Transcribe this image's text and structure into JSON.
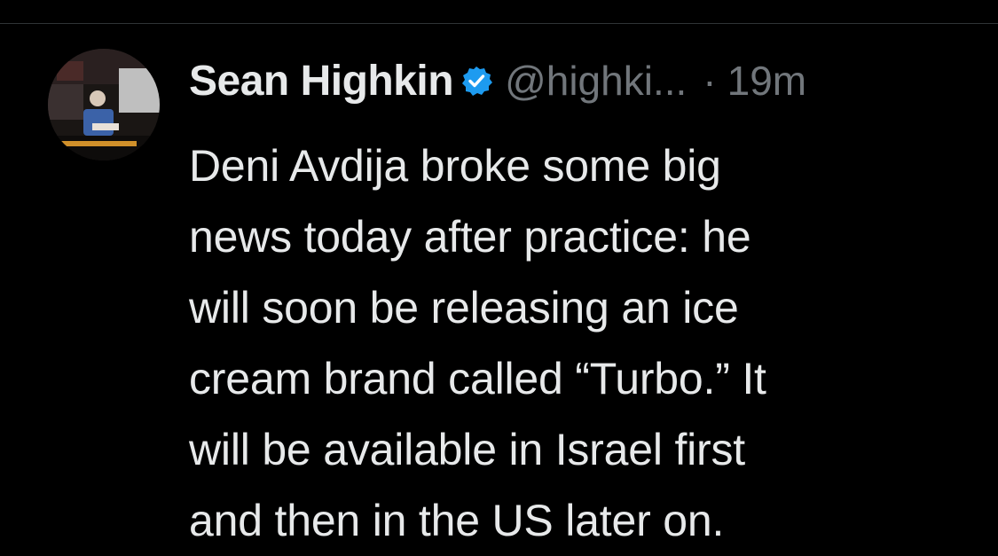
{
  "tweet": {
    "author": {
      "display_name": "Sean Highkin",
      "handle": "@highki...",
      "verified": true
    },
    "separator": "·",
    "time": "19m",
    "text": "Deni Avdija broke some big\nnews today after practice: he\nwill soon be releasing an ice\ncream brand called “Turbo.” It\nwill be available in Israel first\nand then in the US later on."
  },
  "colors": {
    "background": "#000000",
    "primary_text": "#e7e9ea",
    "secondary_text": "#71767b",
    "verified_badge": "#1d9bf0",
    "divider": "#2f3336"
  }
}
